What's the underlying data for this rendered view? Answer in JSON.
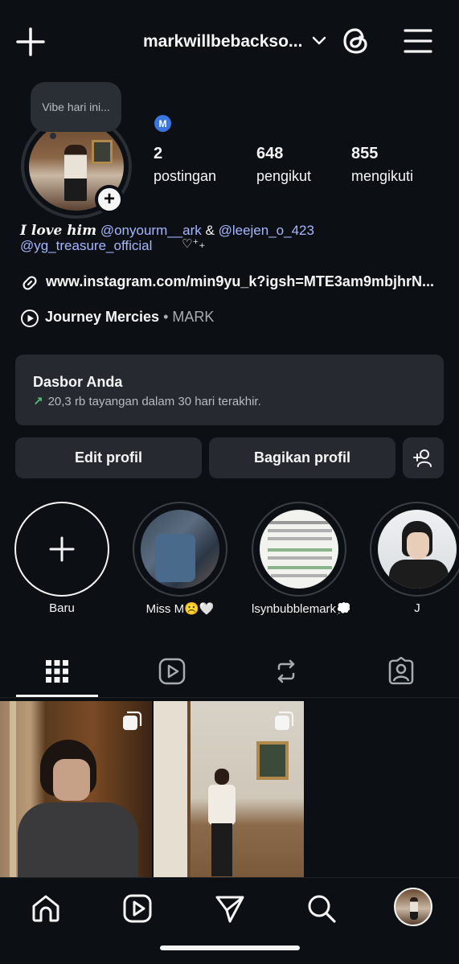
{
  "header": {
    "username": "markwillbebackso...",
    "icons": [
      "plus-icon",
      "chevron-down-icon",
      "threads-icon",
      "menu-icon"
    ]
  },
  "profile": {
    "note": "Vibe hari ini...",
    "meta_badge": "M",
    "stats": [
      {
        "value": "2",
        "label": "postingan"
      },
      {
        "value": "648",
        "label": "pengikut"
      },
      {
        "value": "855",
        "label": "mengikuti"
      }
    ],
    "bio": {
      "lead": "I love him",
      "mention1": "@onyourm__ark",
      "amp": "&",
      "mention2": "@leejen_o_423",
      "mention3": "@yg_treasure_official",
      "heart": "♡⁺₊"
    },
    "link": "www.instagram.com/min9yu_k?igsh=MTE3am9mbjhrN...",
    "music": {
      "title": "Journey Mercies",
      "separator": " • ",
      "artist": "MARK"
    }
  },
  "dashboard": {
    "title": "Dasbor Anda",
    "subtitle": "20,3 rb tayangan dalam 30 hari terakhir."
  },
  "buttons": {
    "edit": "Edit profil",
    "share": "Bagikan profil"
  },
  "highlights": [
    {
      "label": "Baru"
    },
    {
      "label": "Miss M☹️🤍"
    },
    {
      "label": "lsynbubblemark💭"
    },
    {
      "label": "J"
    }
  ],
  "colors": {
    "background": "#0c1014",
    "surface": "#262a30",
    "mention": "#a6b6ff",
    "trend": "#4ec27a",
    "meta_badge": "#3b76e0"
  }
}
